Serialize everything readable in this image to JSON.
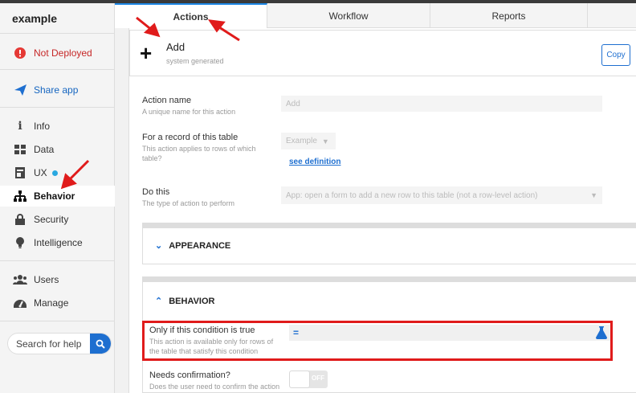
{
  "app": {
    "name": "example"
  },
  "sidebar": {
    "deploy": {
      "label": "Not Deployed",
      "icon": "alert-circle-icon"
    },
    "share": {
      "label": "Share app",
      "icon": "send-icon"
    },
    "items": [
      {
        "label": "Info",
        "icon": "info-icon"
      },
      {
        "label": "Data",
        "icon": "table-icon"
      },
      {
        "label": "UX",
        "icon": "ux-icon"
      },
      {
        "label": "Behavior",
        "icon": "sitemap-icon"
      },
      {
        "label": "Security",
        "icon": "lock-icon"
      },
      {
        "label": "Intelligence",
        "icon": "bulb-icon"
      }
    ],
    "bottom": [
      {
        "label": "Users",
        "icon": "users-icon"
      },
      {
        "label": "Manage",
        "icon": "dashboard-icon"
      }
    ],
    "search_placeholder": "Search for help"
  },
  "tabs": [
    {
      "label": "Actions",
      "active": true
    },
    {
      "label": "Workflow"
    },
    {
      "label": "Reports"
    }
  ],
  "action": {
    "title": "Add",
    "subtitle": "system generated",
    "copy_label": "Copy"
  },
  "form": {
    "action_name": {
      "label": "Action name",
      "hint": "A unique name for this action",
      "value": "Add"
    },
    "table": {
      "label": "For a record of this table",
      "hint": "This action applies to rows of which table?",
      "value": "Example",
      "link": "see definition"
    },
    "do_this": {
      "label": "Do this",
      "hint": "The type of action to perform",
      "value": "App: open a form to add a new row to this table (not a row-level action)"
    }
  },
  "sections": {
    "appearance": "APPEARANCE",
    "behavior": "BEHAVIOR"
  },
  "behavior": {
    "condition": {
      "label": "Only if this condition is true",
      "hint": "This action is available only for rows of the table that satisfy this condition",
      "prefix": "="
    },
    "confirm": {
      "label": "Needs confirmation?",
      "hint": "Does the user need to confirm the action",
      "toggle": "OFF"
    }
  },
  "colors": {
    "accent": "#1e6fd0",
    "highlight": "#e01b1b",
    "deploy": "#c62828"
  }
}
